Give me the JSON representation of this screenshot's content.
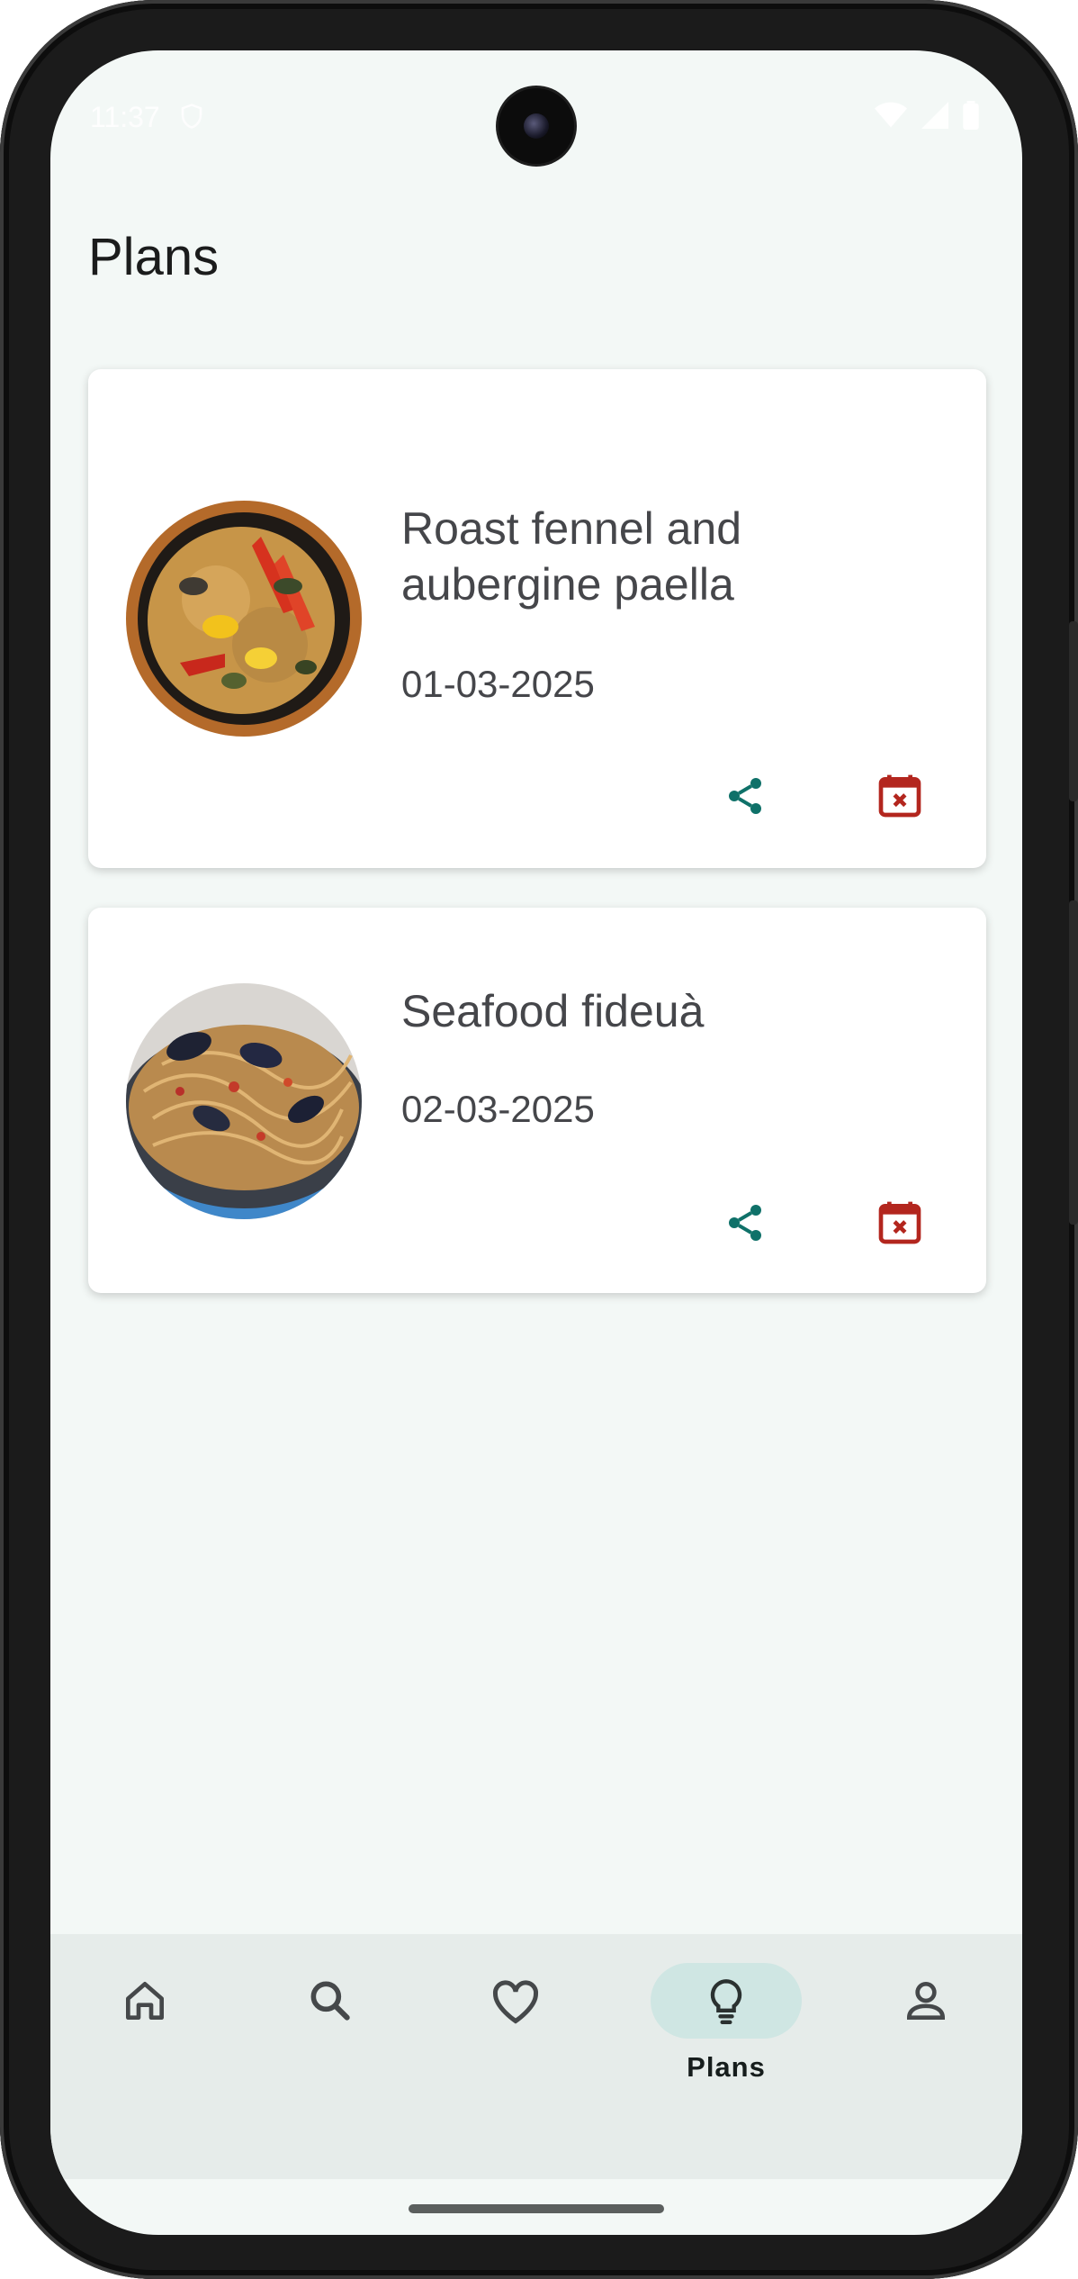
{
  "status_bar": {
    "time": "11:37"
  },
  "page": {
    "title": "Plans"
  },
  "plans": [
    {
      "name": "Roast fennel and aubergine paella",
      "date": "01-03-2025",
      "image": "paella-photo"
    },
    {
      "name": "Seafood fideuà",
      "date": "02-03-2025",
      "image": "fideua-photo"
    }
  ],
  "bottom_nav": {
    "items": [
      {
        "icon": "home-icon",
        "label": ""
      },
      {
        "icon": "search-icon",
        "label": ""
      },
      {
        "icon": "heart-icon",
        "label": ""
      },
      {
        "icon": "lightbulb-icon",
        "label": "Plans",
        "active": true
      },
      {
        "icon": "person-icon",
        "label": ""
      }
    ]
  },
  "colors": {
    "background": "#f3f8f6",
    "share": "#0f7169",
    "remove": "#b3261e",
    "nav_active_pill": "#cfe6e3",
    "navbar": "#e6ecea"
  }
}
